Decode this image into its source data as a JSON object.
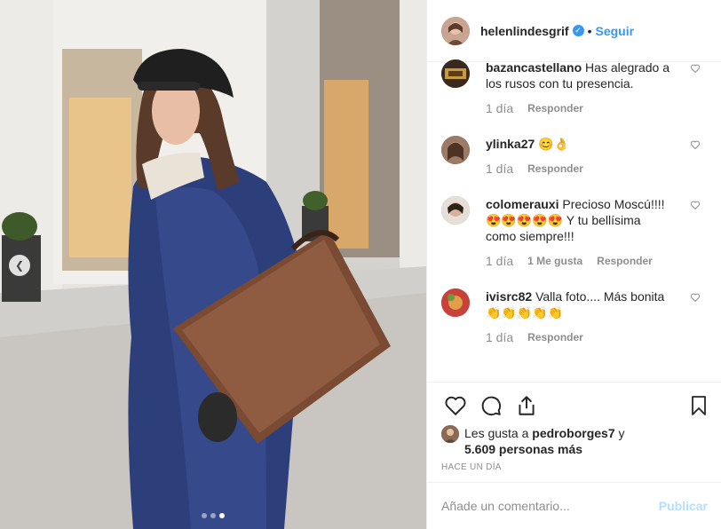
{
  "post": {
    "username": "helenlindesgrif",
    "follow_label": "Seguir",
    "separator": "•"
  },
  "comments": [
    {
      "user": "bazancastellano",
      "text": "Has alegrado a los rusos con tu presencia.",
      "age": "1 día",
      "likes": "",
      "reply": "Responder"
    },
    {
      "user": "ylinka27",
      "text": "😊👌",
      "age": "1 día",
      "likes": "",
      "reply": "Responder"
    },
    {
      "user": "colomerauxi",
      "text": "Precioso Moscú!!!! 😍😍😍😍😍 Y tu bellísima como siempre!!!",
      "age": "1 día",
      "likes": "1 Me gusta",
      "reply": "Responder"
    },
    {
      "user": "ivisrc82",
      "text": "Valla foto.... Más bonita 👏👏👏👏👏",
      "age": "1 día",
      "likes": "",
      "reply": "Responder"
    }
  ],
  "likes": {
    "prefix": "Les gusta a",
    "user": "pedroborges7",
    "joiner": "y",
    "count": "5.609 personas más"
  },
  "time_ago": "HACE UN DÍA",
  "add_comment": {
    "placeholder": "Añade un comentario...",
    "publish_label": "Publicar"
  },
  "carousel": {
    "slides": 3,
    "active": 3
  },
  "colors": {
    "accent": "#3897f0",
    "publish_disabled": "#b2dffc",
    "muted": "#8e8e8e"
  }
}
